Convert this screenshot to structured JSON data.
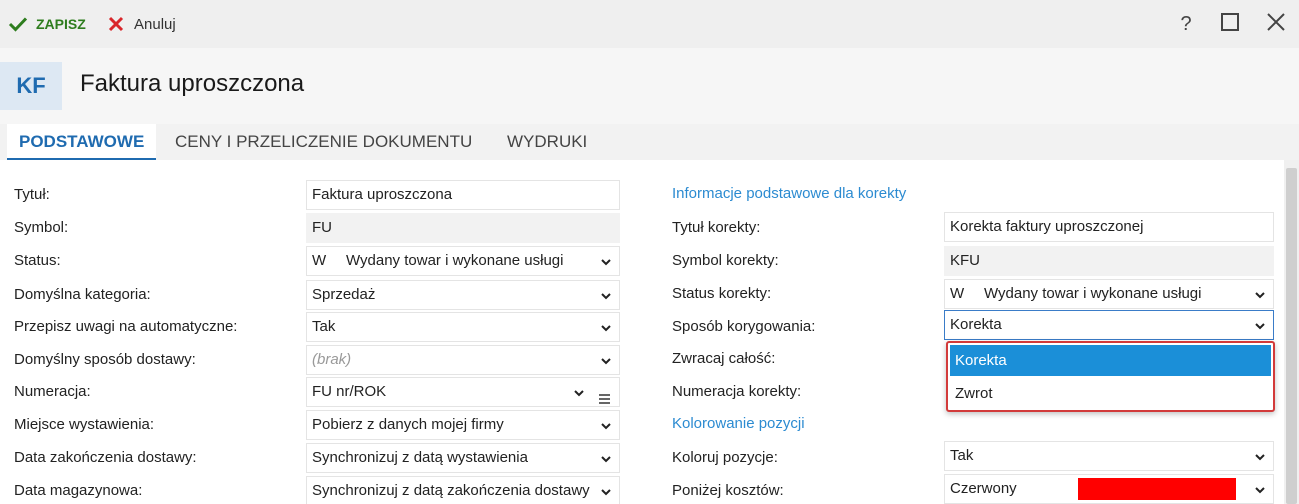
{
  "toolbar": {
    "save_label": "ZAPISZ",
    "cancel_label": "Anuluj",
    "help_label": "?"
  },
  "header": {
    "badge": "KF",
    "title": "Faktura uproszczona"
  },
  "tabs": [
    {
      "label": "PODSTAWOWE"
    },
    {
      "label": "CENY I PRZELICZENIE DOKUMENTU"
    },
    {
      "label": "WYDRUKI"
    }
  ],
  "left": {
    "rows": [
      {
        "label": "Tytuł:",
        "value": "Faktura uproszczona"
      },
      {
        "label": "Symbol:",
        "value": "FU"
      },
      {
        "label": "Status:",
        "code": "W",
        "value": "Wydany towar i wykonane usługi"
      },
      {
        "label": "Domyślna kategoria:",
        "value": "Sprzedaż"
      },
      {
        "label": "Przepisz uwagi na automatyczne:",
        "value": "Tak"
      },
      {
        "label": "Domyślny sposób dostawy:",
        "placeholder": "(brak)"
      },
      {
        "label": "Numeracja:",
        "value": "FU nr/ROK"
      },
      {
        "label": "Miejsce wystawienia:",
        "value": "Pobierz z danych mojej firmy"
      },
      {
        "label": "Data zakończenia dostawy:",
        "value": "Synchronizuj z datą wystawienia"
      },
      {
        "label": "Data magazynowa:",
        "value": "Synchronizuj z datą zakończenia dostawy"
      }
    ]
  },
  "right": {
    "section1": "Informacje podstawowe dla korekty",
    "section2": "Kolorowanie pozycji",
    "rows": [
      {
        "label": "Tytuł korekty:",
        "value": "Korekta faktury uproszczonej"
      },
      {
        "label": "Symbol korekty:",
        "value": "KFU"
      },
      {
        "label": "Status korekty:",
        "code": "W",
        "value": "Wydany towar i wykonane usługi"
      },
      {
        "label": "Sposób korygowania:",
        "value": "Korekta"
      },
      {
        "label": "Zwracaj całość:"
      },
      {
        "label": "Numeracja korekty:"
      },
      {
        "label": "Koloruj pozycje:",
        "value": "Tak"
      },
      {
        "label": "Poniżej kosztów:",
        "value": "Czerwony"
      }
    ],
    "dropdown_options": [
      "Korekta",
      "Zwrot"
    ]
  },
  "colors": {
    "accent": "#1f6bb0",
    "save_green": "#2e7d1e",
    "cancel_red": "#d9262b",
    "dropdown_selected": "#1b8fd8",
    "swatch_red": "#ff0000"
  },
  "icons": {
    "save": "check-icon",
    "cancel": "x-icon",
    "help": "question-icon",
    "maximize": "square-icon",
    "close": "close-icon",
    "dropdown": "chevron-down-icon",
    "list": "list-icon"
  }
}
